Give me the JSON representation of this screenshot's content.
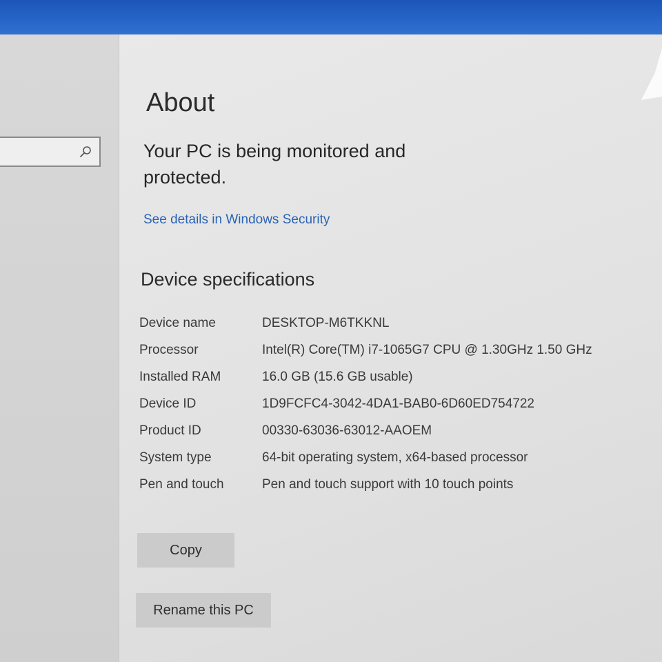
{
  "page": {
    "title": "About",
    "protection_message": "Your PC is being monitored and protected.",
    "security_link": "See details in Windows Security"
  },
  "search": {
    "icon": "search-icon",
    "value": ""
  },
  "device_specifications": {
    "heading": "Device specifications",
    "rows": [
      {
        "label": "Device name",
        "value": "DESKTOP-M6TKKNL"
      },
      {
        "label": "Processor",
        "value": "Intel(R) Core(TM) i7-1065G7 CPU @ 1.30GHz   1.50 GHz"
      },
      {
        "label": "Installed RAM",
        "value": "16.0 GB (15.6 GB usable)"
      },
      {
        "label": "Device ID",
        "value": "1D9FCFC4-3042-4DA1-BAB0-6D60ED754722"
      },
      {
        "label": "Product ID",
        "value": "00330-63036-63012-AAOEM"
      },
      {
        "label": "System type",
        "value": "64-bit operating system, x64-based processor"
      },
      {
        "label": "Pen and touch",
        "value": "Pen and touch support with 10 touch points"
      }
    ]
  },
  "buttons": {
    "copy": "Copy",
    "rename": "Rename this PC"
  },
  "colors": {
    "titlebar": "#2765c8",
    "link": "#2a63b5"
  }
}
